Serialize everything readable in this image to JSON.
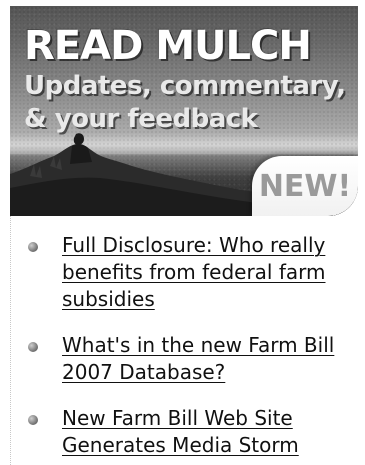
{
  "banner": {
    "title": "READ MULCH",
    "subtitle": "Updates, commentary, & your feedback",
    "badge": "NEW!"
  },
  "news": {
    "items": [
      {
        "label": "Full Disclosure: Who really benefits from federal farm subsidies"
      },
      {
        "label": "What's in the new Farm Bill 2007 Database?"
      },
      {
        "label": "New Farm Bill Web Site Generates Media Storm"
      }
    ]
  },
  "icons": {
    "bullet": "bullet-icon"
  },
  "colors": {
    "title": "#ffffff",
    "subtitle": "#e9e9e9",
    "badge_text": "#9a9a9a",
    "link": "#111111"
  }
}
